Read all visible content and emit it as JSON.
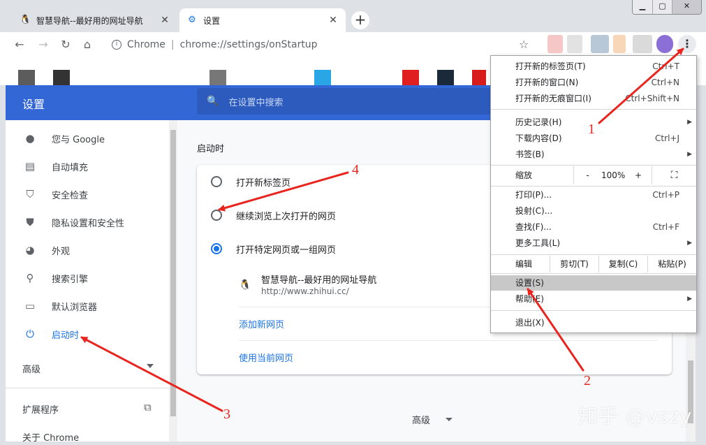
{
  "tabs": [
    {
      "title": "智慧导航--最好用的网址导航",
      "favicon": "🐧",
      "active": false
    },
    {
      "title": "设置",
      "favicon": "⚙",
      "active": true
    }
  ],
  "toolbar": {
    "scheme": "Chrome",
    "url": "chrome://settings/onStartup",
    "sep": "|"
  },
  "settings": {
    "title": "设置",
    "search_placeholder": "在设置中搜索"
  },
  "sidebar": {
    "items": [
      {
        "label": "您与 Google",
        "icon": "person-icon",
        "glyph": "👤"
      },
      {
        "label": "自动填充",
        "icon": "clipboard-icon",
        "glyph": "📋"
      },
      {
        "label": "安全检查",
        "icon": "shield-check-icon",
        "glyph": "🛡"
      },
      {
        "label": "隐私设置和安全性",
        "icon": "shield-icon",
        "glyph": "🛡"
      },
      {
        "label": "外观",
        "icon": "palette-icon",
        "glyph": "🎨"
      },
      {
        "label": "搜索引擎",
        "icon": "search-icon",
        "glyph": "🔍"
      },
      {
        "label": "默认浏览器",
        "icon": "browser-icon",
        "glyph": "▭"
      },
      {
        "label": "启动时",
        "icon": "power-icon",
        "glyph": "⏻"
      }
    ],
    "advanced": "高级",
    "extensions": "扩展程序",
    "about": "关于 Chrome"
  },
  "startup": {
    "section_title": "启动时",
    "options": [
      {
        "label": "打开新标签页",
        "checked": false
      },
      {
        "label": "继续浏览上次打开的网页",
        "checked": false
      },
      {
        "label": "打开特定网页或一组网页",
        "checked": true
      }
    ],
    "site": {
      "name": "智慧导航--最好用的网址导航",
      "url": "http://www.zhihui.cc/",
      "favicon": "🐧"
    },
    "add_page": "添加新网页",
    "use_current": "使用当前网页",
    "advanced": "高级"
  },
  "menu": {
    "group1": [
      {
        "label": "打开新的标签页(T)",
        "shortcut": "Ctrl+T"
      },
      {
        "label": "打开新的窗口(N)",
        "shortcut": "Ctrl+N"
      },
      {
        "label": "打开新的无痕窗口(I)",
        "shortcut": "Ctrl+Shift+N"
      }
    ],
    "group2": [
      {
        "label": "历史记录(H)",
        "shortcut": "",
        "submenu": true
      },
      {
        "label": "下载内容(D)",
        "shortcut": "Ctrl+J",
        "submenu": false
      },
      {
        "label": "书签(B)",
        "shortcut": "",
        "submenu": true
      }
    ],
    "zoom": {
      "label": "缩放",
      "minus": "-",
      "value": "100%",
      "plus": "+"
    },
    "group3": [
      {
        "label": "打印(P)...",
        "shortcut": "Ctrl+P",
        "submenu": false
      },
      {
        "label": "投射(C)...",
        "shortcut": "",
        "submenu": false
      },
      {
        "label": "查找(F)...",
        "shortcut": "Ctrl+F",
        "submenu": false
      },
      {
        "label": "更多工具(L)",
        "shortcut": "",
        "submenu": true
      }
    ],
    "edit": {
      "label": "编辑",
      "cut": "剪切(T)",
      "copy": "复制(C)",
      "paste": "粘贴(P)"
    },
    "group4": [
      {
        "label": "设置(S)",
        "highlighted": true,
        "submenu": false
      },
      {
        "label": "帮助(E)",
        "highlighted": false,
        "submenu": true
      }
    ],
    "exit": "退出(X)"
  },
  "annotations": [
    "1",
    "2",
    "3",
    "4"
  ],
  "watermark": "知乎 @vszy",
  "colors": {
    "accent": "#1a73e8",
    "header": "#3367d6",
    "annotation": "#e8251f"
  }
}
